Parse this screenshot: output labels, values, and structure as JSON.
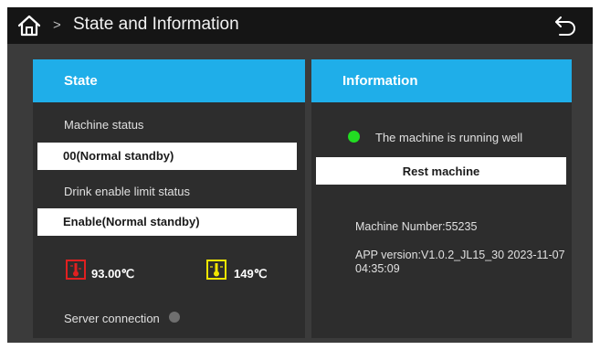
{
  "header": {
    "title": "State and Information",
    "breadcrumb_separator": ">",
    "home_icon": "home-icon",
    "back_icon": "back-arrow-icon"
  },
  "state_panel": {
    "title": "State",
    "machine_status_label": "Machine status",
    "machine_status_value": "00(Normal standby)",
    "drink_limit_label": "Drink enable limit status",
    "drink_limit_value": "Enable(Normal standby)",
    "temperature_1": "93.00℃",
    "temperature_2": "149℃",
    "server_connection_label": "Server connection"
  },
  "info_panel": {
    "title": "Information",
    "running_status": "The machine is running well",
    "reset_button_label": "Rest machine",
    "machine_number": "Machine Number:55235",
    "app_version": "APP version:V1.0.2_JL15_30 2023-11-07 04:35:09"
  },
  "colors": {
    "accent": "#1faee9",
    "background": "#3b3b3b",
    "panel": "#2d2d2d",
    "topbar": "#151515",
    "status_ok": "#22dd22",
    "server_offline": "#6f6f6f",
    "temp_icon_1": "#e02020",
    "temp_icon_2": "#f2e600"
  }
}
